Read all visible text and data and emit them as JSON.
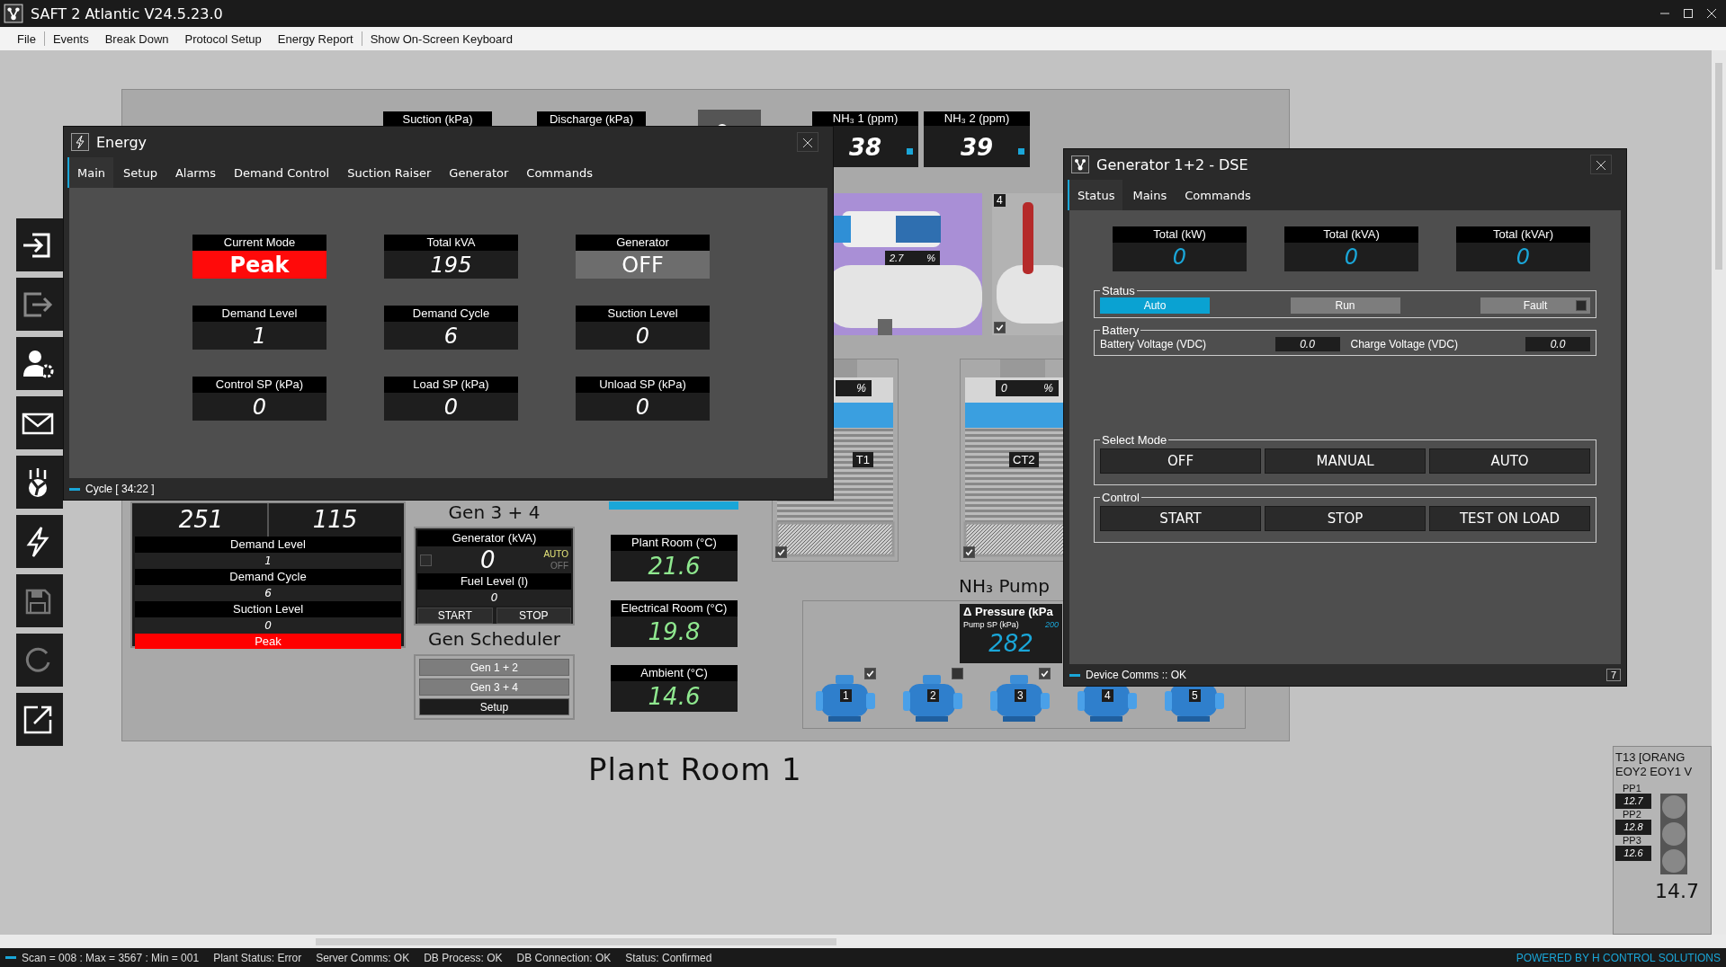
{
  "window": {
    "title": "SAFT 2 Atlantic V24.5.23.0"
  },
  "menu": [
    [
      "File"
    ],
    [
      "Events",
      "Break Down",
      "Protocol Setup",
      "Energy Report"
    ],
    [
      "Show On-Screen Keyboard"
    ]
  ],
  "plant": {
    "title": "Plant Room 1",
    "header_labels": [
      "Suction (kPa)",
      "Discharge (kPa)"
    ],
    "gas_sensors": [
      {
        "label": "NH₃ 1 (ppm)",
        "value": "38",
        "active": true
      },
      {
        "label": "NH₃ 2 (ppm)",
        "value": "39",
        "active": true
      }
    ],
    "compressor": {
      "reading": "2.7",
      "unit": "%"
    },
    "vessel": {
      "badge": "4",
      "checked": true
    },
    "cooling_towers": [
      {
        "label": "T1",
        "unit": "%",
        "checked": true
      },
      {
        "label": "CT2",
        "reading": "0",
        "unit": "%",
        "checked": true
      }
    ],
    "demand_panel": {
      "values": [
        "251",
        "115"
      ],
      "rows": [
        {
          "label": "Demand Level",
          "value": "1"
        },
        {
          "label": "Demand Cycle",
          "value": "6"
        },
        {
          "label": "Suction Level",
          "value": "0"
        }
      ],
      "mode": "Peak"
    },
    "gen34": {
      "title": "Gen 3 + 4",
      "label": "Generator (kVA)",
      "value": "0",
      "checked": false,
      "auto": "AUTO",
      "off": "OFF",
      "fuel_label": "Fuel Level (l)",
      "fuel": "0",
      "buttons": [
        "START",
        "STOP"
      ]
    },
    "scheduler": {
      "title": "Gen Scheduler",
      "buttons": [
        {
          "label": "Gen 1 + 2",
          "kind": "schedule"
        },
        {
          "label": "Gen 3 + 4",
          "kind": "schedule"
        },
        {
          "label": "Setup",
          "kind": "setup"
        }
      ]
    },
    "temperatures": [
      {
        "label": "Plant Room (°C)",
        "value": "21.6"
      },
      {
        "label": "Electrical Room (°C)",
        "value": "19.8"
      },
      {
        "label": "Ambient (°C)",
        "value": "14.6"
      }
    ],
    "pumps": {
      "title": "NH₃ Pump",
      "pressure_label": "Δ Pressure (kPa",
      "sp_label": "Pump SP (kPa)",
      "sp_value": "200",
      "value": "282",
      "units": [
        {
          "number": "1",
          "checked": true
        },
        {
          "number": "2",
          "checked": false
        },
        {
          "number": "3",
          "checked": true
        },
        {
          "number": "4"
        },
        {
          "number": "5"
        }
      ]
    }
  },
  "side_panel": {
    "title_lines": [
      "T13 [ORANG",
      "EOY2 EOY1 V"
    ],
    "readings": [
      {
        "label": "PP1",
        "value": "12.7"
      },
      {
        "label": "PP2",
        "value": "12.8"
      },
      {
        "label": "PP3",
        "value": "12.6"
      }
    ],
    "value": "14.7"
  },
  "energy_window": {
    "title": "Energy",
    "tabs": [
      {
        "label": "Main",
        "selected": true
      },
      {
        "label": "Setup",
        "selected": false
      },
      {
        "label": "Alarms",
        "selected": false
      },
      {
        "label": "Demand Control",
        "selected": false
      },
      {
        "label": "Suction Raiser",
        "selected": false
      },
      {
        "label": "Generator",
        "selected": false
      },
      {
        "label": "Commands",
        "selected": false
      }
    ],
    "tiles": [
      {
        "label": "Current Mode",
        "value": "Peak",
        "kind": "mode"
      },
      {
        "label": "Total kVA",
        "value": "195",
        "kind": "number"
      },
      {
        "label": "Generator",
        "value": "OFF",
        "kind": "state"
      },
      {
        "label": "Demand Level",
        "value": "1",
        "kind": "number"
      },
      {
        "label": "Demand Cycle",
        "value": "6",
        "kind": "number"
      },
      {
        "label": "Suction Level",
        "value": "0",
        "kind": "number"
      },
      {
        "label": "Control SP (kPa)",
        "value": "0",
        "kind": "number"
      },
      {
        "label": "Load SP (kPa)",
        "value": "0",
        "kind": "number"
      },
      {
        "label": "Unload SP (kPa)",
        "value": "0",
        "kind": "number"
      }
    ],
    "footer": "Cycle [ 34:22 ]"
  },
  "generator_window": {
    "title": "Generator 1+2 - DSE",
    "tabs": [
      {
        "label": "Status",
        "selected": true
      },
      {
        "label": "Mains",
        "selected": false
      },
      {
        "label": "Commands",
        "selected": false
      }
    ],
    "totals": [
      {
        "label": "Total (kW)",
        "value": "0"
      },
      {
        "label": "Total (kVA)",
        "value": "0"
      },
      {
        "label": "Total (kVAr)",
        "value": "0"
      }
    ],
    "status": {
      "title": "Status",
      "indicators": [
        {
          "label": "Auto",
          "on": true,
          "kind": "plain"
        },
        {
          "label": "Run",
          "on": false,
          "kind": "plain"
        },
        {
          "label": "Fault",
          "on": false,
          "kind": "fault"
        }
      ]
    },
    "battery": {
      "title": "Battery",
      "fields": [
        {
          "label": "Battery Voltage (VDC)",
          "value": "0.0"
        },
        {
          "label": "Charge Voltage (VDC)",
          "value": "0.0"
        }
      ]
    },
    "select_mode": {
      "title": "Select Mode",
      "buttons": [
        "OFF",
        "MANUAL",
        "AUTO"
      ]
    },
    "control": {
      "title": "Control",
      "buttons": [
        "START",
        "STOP",
        "TEST ON LOAD"
      ]
    },
    "footer": "Device Comms :: OK",
    "page": "7"
  },
  "status_bar": {
    "items": [
      "Scan = 008 : Max = 3567 : Min = 001",
      "Plant Status: Error",
      "Server Comms: OK",
      "DB Process: OK",
      "DB Connection: OK",
      "Status: Confirmed"
    ],
    "brand": "POWERED BY H CONTROL SOLUTIONS"
  }
}
